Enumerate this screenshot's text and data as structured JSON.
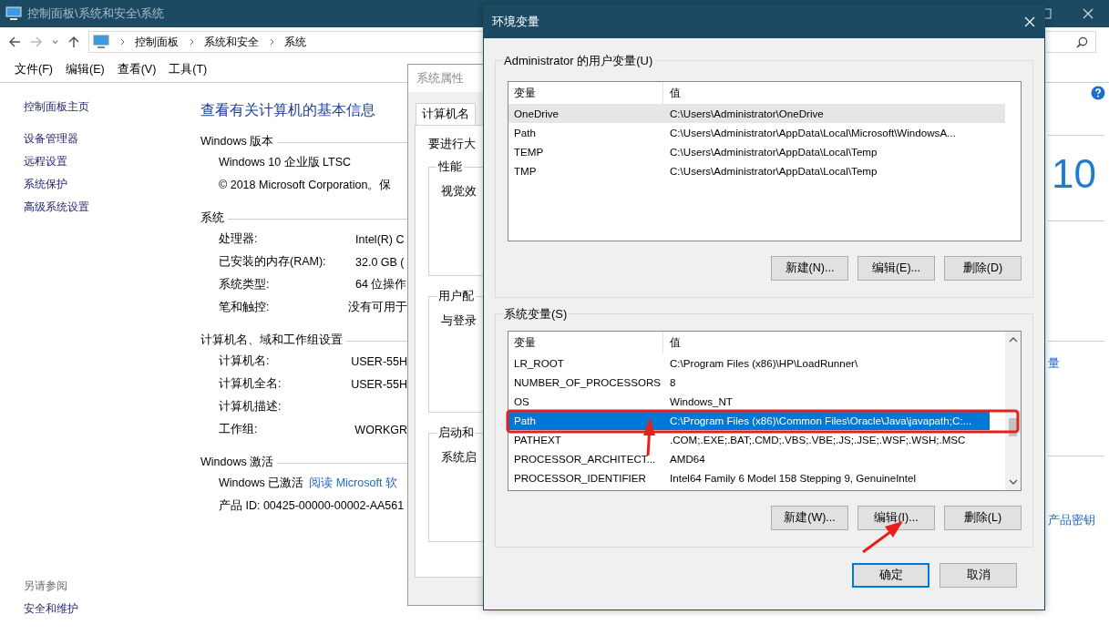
{
  "main_window": {
    "title": "控制面板\\系统和安全\\系统",
    "breadcrumbs": [
      "控制面板",
      "系统和安全",
      "系统"
    ],
    "menu": [
      "文件(F)",
      "编辑(E)",
      "查看(V)",
      "工具(T)"
    ],
    "sidebar": {
      "items": [
        "控制面板主页",
        "设备管理器",
        "远程设置",
        "系统保护",
        "高级系统设置"
      ],
      "see_also_heading": "另请参阅",
      "see_also": [
        "安全和维护"
      ]
    },
    "heading": "查看有关计算机的基本信息",
    "sections": [
      {
        "title": "Windows 版本",
        "rows": [
          {
            "kind": "text",
            "text": "Windows 10 企业版 LTSC"
          },
          {
            "kind": "text",
            "text": "© 2018 Microsoft Corporation。保"
          }
        ]
      },
      {
        "title": "系统",
        "rows": [
          {
            "kind": "pair",
            "label": "处理器:",
            "value": "Intel(R) C"
          },
          {
            "kind": "pair",
            "label": "已安装的内存(RAM):",
            "value": "32.0 GB ("
          },
          {
            "kind": "pair",
            "label": "系统类型:",
            "value": "64 位操作"
          },
          {
            "kind": "pair",
            "label": "笔和触控:",
            "value": "没有可用于"
          }
        ]
      },
      {
        "title": "计算机名、域和工作组设置",
        "rows": [
          {
            "kind": "pair",
            "label": "计算机名:",
            "value": "USER-55H"
          },
          {
            "kind": "pair",
            "label": "计算机全名:",
            "value": "USER-55H"
          },
          {
            "kind": "pair",
            "label": "计算机描述:",
            "value": ""
          },
          {
            "kind": "pair",
            "label": "工作组:",
            "value": "WORKGR"
          }
        ]
      },
      {
        "title": "Windows 激活",
        "rows": [
          {
            "kind": "link",
            "text": "Windows 已激活",
            "link": "阅读 Microsoft 软"
          },
          {
            "kind": "text",
            "text": "产品 ID: 00425-00000-00002-AA561"
          }
        ]
      }
    ],
    "logo_text": "10",
    "link_fragment": "量",
    "product_key_link": "产品密钥"
  },
  "system_properties": {
    "title": "系统属性",
    "tab": "计算机名",
    "intro": "要进行大",
    "groups": [
      {
        "title": "性能",
        "text": "视觉效"
      },
      {
        "title": "用户配",
        "text": "与登录"
      },
      {
        "title": "启动和",
        "text": "系统启"
      }
    ]
  },
  "env_dialog": {
    "title": "环境变量",
    "lists": [
      {
        "title": "Administrator 的用户变量(U)",
        "focused": false,
        "scrollbar": false,
        "columns": [
          "变量",
          "值"
        ],
        "rows": [
          {
            "name": "OneDrive",
            "value": "C:\\Users\\Administrator\\OneDrive",
            "selected": true
          },
          {
            "name": "Path",
            "value": "C:\\Users\\Administrator\\AppData\\Local\\Microsoft\\WindowsA...",
            "selected": false
          },
          {
            "name": "TEMP",
            "value": "C:\\Users\\Administrator\\AppData\\Local\\Temp",
            "selected": false
          },
          {
            "name": "TMP",
            "value": "C:\\Users\\Administrator\\AppData\\Local\\Temp",
            "selected": false
          }
        ],
        "buttons": [
          "新建(N)...",
          "编辑(E)...",
          "删除(D)"
        ]
      },
      {
        "title": "系统变量(S)",
        "focused": true,
        "scrollbar": true,
        "columns": [
          "变量",
          "值"
        ],
        "rows": [
          {
            "name": "LR_ROOT",
            "value": "C:\\Program Files (x86)\\HP\\LoadRunner\\",
            "selected": false
          },
          {
            "name": "NUMBER_OF_PROCESSORS",
            "value": "8",
            "selected": false
          },
          {
            "name": "OS",
            "value": "Windows_NT",
            "selected": false
          },
          {
            "name": "Path",
            "value": "C:\\Program Files (x86)\\Common Files\\Oracle\\Java\\javapath;C:...",
            "selected": true
          },
          {
            "name": "PATHEXT",
            "value": ".COM;.EXE;.BAT;.CMD;.VBS;.VBE;.JS;.JSE;.WSF;.WSH;.MSC",
            "selected": false
          },
          {
            "name": "PROCESSOR_ARCHITECT...",
            "value": "AMD64",
            "selected": false
          },
          {
            "name": "PROCESSOR_IDENTIFIER",
            "value": "Intel64 Family 6 Model 158 Stepping 9, GenuineIntel",
            "selected": false
          }
        ],
        "buttons": [
          "新建(W)...",
          "编辑(I)...",
          "删除(L)"
        ]
      }
    ],
    "footer_buttons": [
      {
        "label": "确定",
        "default": true
      },
      {
        "label": "取消",
        "default": false
      }
    ]
  }
}
